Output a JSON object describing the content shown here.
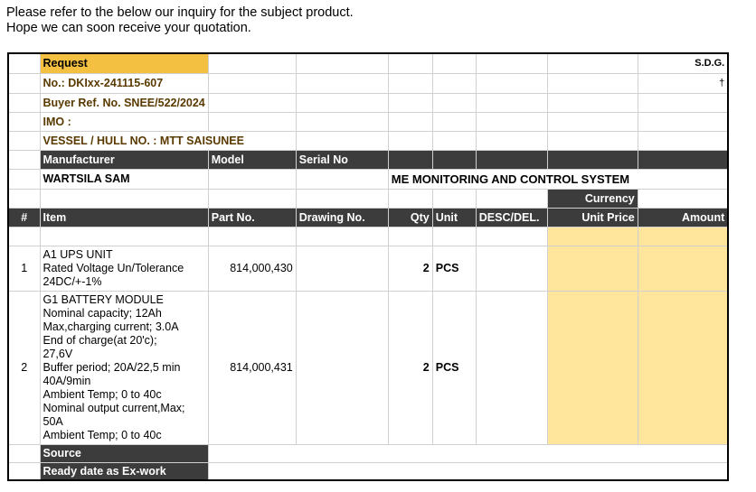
{
  "intro": {
    "line1": "Please refer to the below our inquiry for the subject product.",
    "line2": "Hope we can soon receive your quotation."
  },
  "header": {
    "request": "Request",
    "no": "No.:  DKIxx-241115-607",
    "buyer_ref": "Buyer Ref. No. SNEE/522/2024",
    "imo": "IMO :",
    "vessel": "VESSEL / HULL NO. : MTT SAISUNEE",
    "sdg": "S.D.G.",
    "dagger": "†"
  },
  "info_header": {
    "manufacturer": "Manufacturer",
    "model": "Model",
    "serial": "Serial No"
  },
  "info_values": {
    "manufacturer": "WARTSILA SAM",
    "system": "ME MONITORING AND CONTROL SYSTEM"
  },
  "currency_label": "Currency",
  "columns": {
    "num": "#",
    "item": "Item",
    "part_no": "Part No.",
    "drawing_no": "Drawing No.",
    "qty": "Qty",
    "unit": "Unit",
    "desc": "DESC/DEL.",
    "unit_price": "Unit Price",
    "amount": "Amount"
  },
  "items": [
    {
      "num": "1",
      "lines": [
        "A1 UPS UNIT",
        "Rated Voltage Un/Tolerance",
        "24DC/+-1%"
      ],
      "part_no": "814,000,430",
      "qty": "2",
      "unit": "PCS"
    },
    {
      "num": "2",
      "lines": [
        "G1 BATTERY MODULE",
        "Nominal capacity; 12Ah",
        "Max,charging current; 3.0A",
        "End of charge(at 20'c);",
        "27,6V",
        "Buffer period; 20A/22,5 min",
        "40A/9min",
        "Ambient Temp; 0 to 40c",
        "Nominal output current,Max;",
        "50A",
        "Ambient Temp; 0 to 40c"
      ],
      "part_no": "814,000,431",
      "qty": "2",
      "unit": "PCS"
    }
  ],
  "footer": {
    "source": "Source",
    "ready_date": "Ready date as Ex-work"
  },
  "colors": {
    "request_fill": "#f4c042",
    "header_fill": "#3c3c3c",
    "price_fill": "#ffe69c"
  }
}
